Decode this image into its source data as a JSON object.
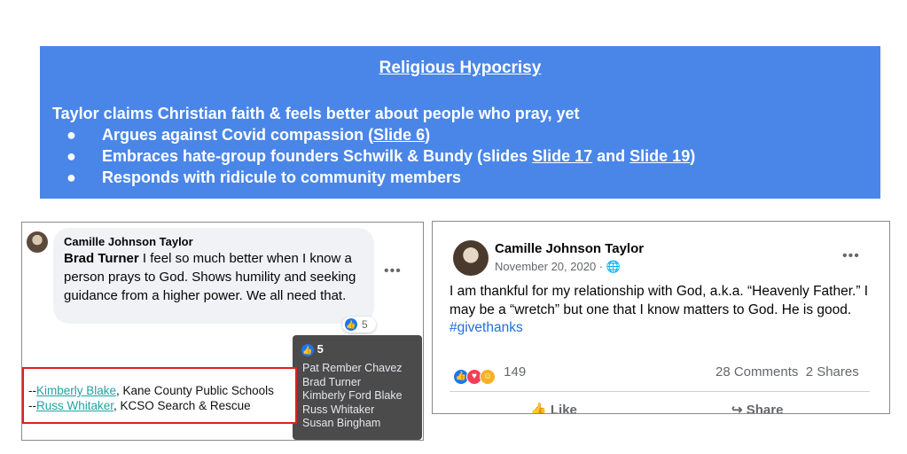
{
  "banner": {
    "title": "Religious Hypocrisy",
    "intro": "Taylor claims Christian faith & feels better about people who pray, yet",
    "bullet_glyph": "●",
    "bullets": [
      {
        "pre": "Argues against Covid compassion (",
        "link1": "Slide 6",
        "mid": ")",
        "link2": "",
        "post": ""
      },
      {
        "pre": "Embraces hate-group founders Schwilk & Bundy (slides ",
        "link1": "Slide 17",
        "mid": " and ",
        "link2": "Slide 19",
        "post": ")"
      },
      {
        "pre": "Responds with ridicule to community members",
        "link1": "",
        "mid": "",
        "link2": "",
        "post": ""
      }
    ],
    "color": "#4a86e8"
  },
  "comment": {
    "author": "Camille Johnson Taylor",
    "mention": "Brad Turner",
    "text": " I feel so much better when I know a person prays to God. Shows humility and seeking guidance from a higher power. We all need that.",
    "more_icon": "more-horizontal-icon",
    "reaction_count": "5",
    "reaction_icon": "like-icon"
  },
  "tooltip": {
    "count": "5",
    "names": [
      "Pat Rember Chavez",
      "Brad Turner",
      "Kimberly Ford Blake",
      "Russ Whitaker",
      "Susan Bingham"
    ]
  },
  "callout": {
    "line1_prefix": "--",
    "line1_link": "Kimberly Blake",
    "line1_rest": ", Kane County Public Schools",
    "line2_prefix": "--",
    "line2_link": "Russ Whitaker",
    "line2_rest": ", KCSO Search & Rescue",
    "border_color": "#e02020"
  },
  "post": {
    "author": "Camille Johnson Taylor",
    "date": "November 20, 2020 · ",
    "globe_icon": "globe-icon",
    "body": "I am thankful for my relationship with God, a.k.a. “Heavenly Father.” I may be a “wretch” but one that I know matters to God. He is good.",
    "hashtag": "#givethanks",
    "reaction_count": "149",
    "comments_shares": "28 Comments  2 Shares",
    "like_label": "Like",
    "share_label": "Share",
    "link_color": "#216fdb"
  }
}
